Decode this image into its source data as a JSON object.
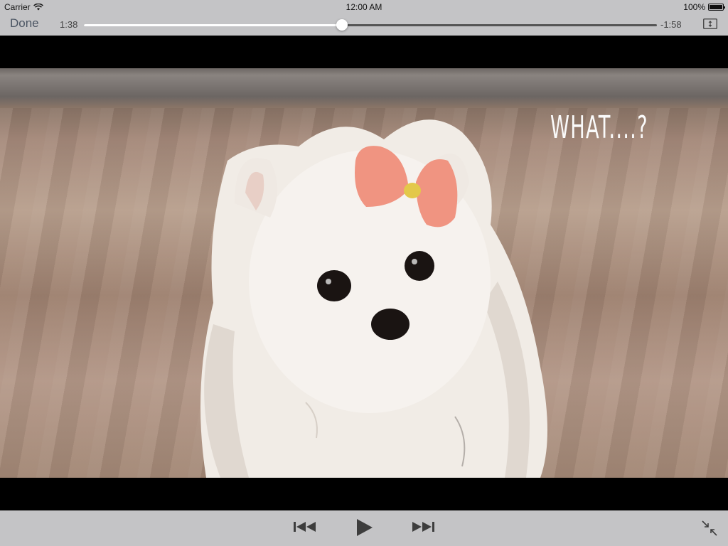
{
  "status_bar": {
    "carrier": "Carrier",
    "time": "12:00 AM",
    "battery_percent": "100%"
  },
  "player": {
    "done_label": "Done",
    "elapsed": "1:38",
    "remaining": "-1:58",
    "progress_fraction": 0.45
  },
  "video": {
    "caption": "WHAT....?"
  },
  "controls": {
    "previous_icon": "skip-back-icon",
    "play_icon": "play-icon",
    "next_icon": "skip-forward-icon",
    "exit_fullscreen_icon": "minimize-icon",
    "aspect_icon": "aspect-fill-icon"
  },
  "colors": {
    "bar_background": "#c4c4c6",
    "control_tint": "#4b5563",
    "letterbox": "#000000"
  }
}
